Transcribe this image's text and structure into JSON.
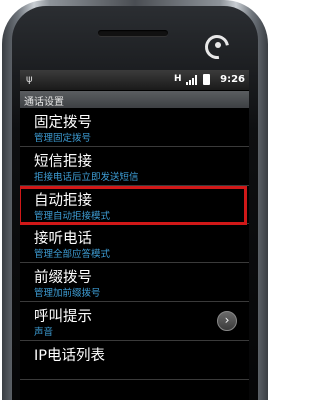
{
  "status_bar": {
    "usb_icon": "usb-icon",
    "network_label": "H",
    "time": "9:26"
  },
  "title": "通话设置",
  "items": [
    {
      "title": "固定拨号",
      "subtitle": "管理固定拨号"
    },
    {
      "title": "短信拒接",
      "subtitle": "拒接电话后立即发送短信"
    },
    {
      "title": "自动拒接",
      "subtitle": "管理自动拒接模式"
    },
    {
      "title": "接听电话",
      "subtitle": "管理全部应答模式"
    },
    {
      "title": "前缀拨号",
      "subtitle": "管理加前缀拨号"
    },
    {
      "title": "呼叫提示",
      "subtitle": "声音"
    },
    {
      "title": "IP电话列表",
      "subtitle": ""
    }
  ],
  "colors": {
    "highlight": "#d01818",
    "subtitle": "#3e9ed6"
  }
}
